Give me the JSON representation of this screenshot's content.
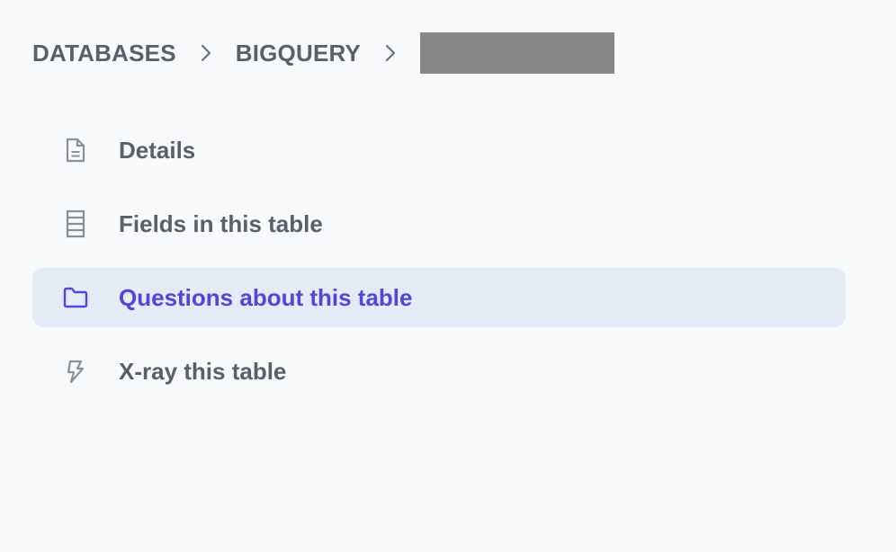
{
  "breadcrumb": {
    "items": [
      {
        "label": "DATABASES"
      },
      {
        "label": "BIGQUERY"
      }
    ],
    "current_redacted": true
  },
  "nav": {
    "items": [
      {
        "label": "Details",
        "icon": "document-icon",
        "active": false
      },
      {
        "label": "Fields in this table",
        "icon": "list-icon",
        "active": false
      },
      {
        "label": "Questions about this table",
        "icon": "folder-icon",
        "active": true
      },
      {
        "label": "X-ray this table",
        "icon": "bolt-icon",
        "active": false
      }
    ]
  },
  "colors": {
    "background": "#f8f9fb",
    "text": "#5a5f6b",
    "icon": "#8a8f9a",
    "active_background": "#e3ebf7",
    "accent": "#5046d8",
    "redaction": "#888888"
  }
}
